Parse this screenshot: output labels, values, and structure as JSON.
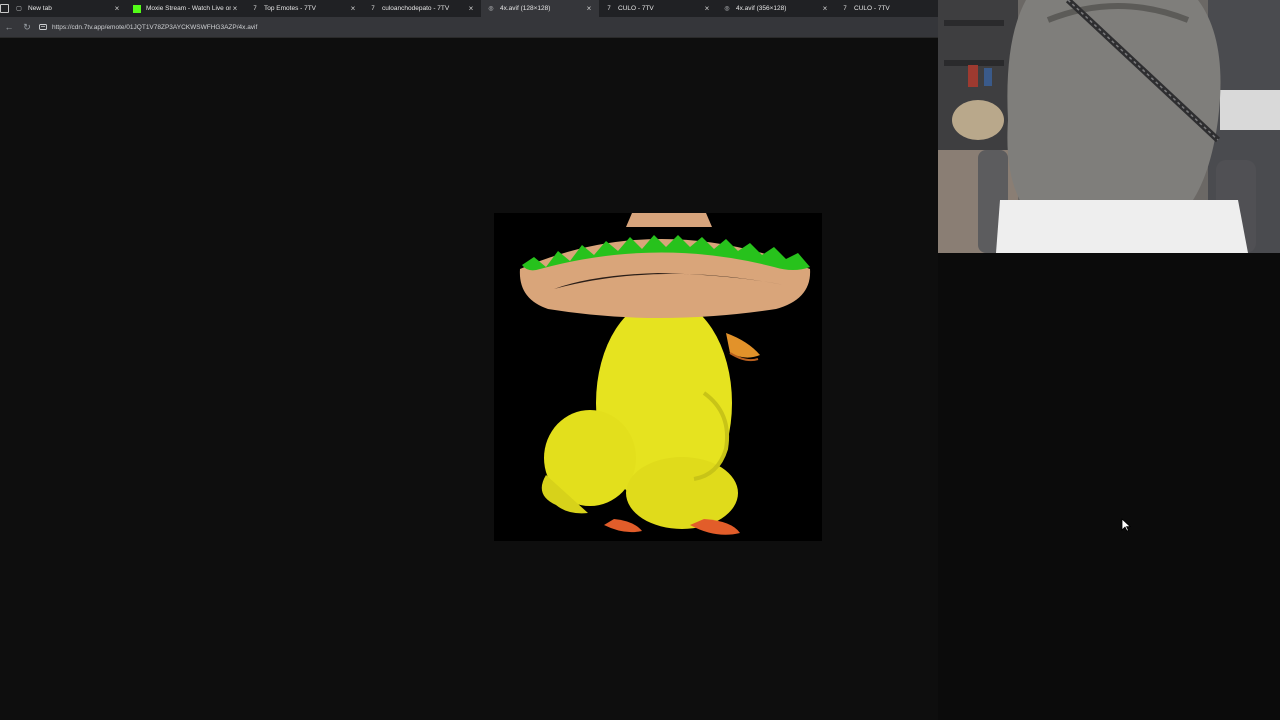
{
  "browser": {
    "tabs": [
      {
        "title": "New tab",
        "icon": "new-tab-page-icon",
        "active": false
      },
      {
        "title": "Moxie Stream - Watch Live on Kick",
        "icon": "kick-logo-icon",
        "active": false
      },
      {
        "title": "Top Emotes - 7TV",
        "icon": "7tv-logo-icon",
        "active": false
      },
      {
        "title": "culoanchodepato - 7TV",
        "icon": "7tv-logo-icon",
        "active": false
      },
      {
        "title": "4x.avif (128×128)",
        "icon": "globe-icon",
        "active": true
      },
      {
        "title": "CULO - 7TV",
        "icon": "7tv-logo-icon",
        "active": false
      },
      {
        "title": "4x.avif (356×128)",
        "icon": "globe-icon",
        "active": false
      },
      {
        "title": "CULO - 7TV",
        "icon": "7tv-logo-icon",
        "active": false
      }
    ],
    "address": {
      "url": "https://cdn.7tv.app/emote/01JQT1V78ZP3AYCKWSWFHG3AZP/4x.avif"
    }
  },
  "colors": {
    "tab_strip": "#202124",
    "active_tab": "#35363a",
    "page_background": "#0e0e0e",
    "duck_yellow": "#e9e61c",
    "sombrero_green": "#27c21c",
    "sombrero_tan": "#d9a57a"
  }
}
